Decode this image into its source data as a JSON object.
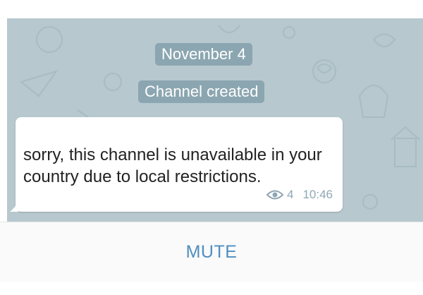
{
  "chat": {
    "date_label": "November 4",
    "service_message": "Channel created",
    "message": {
      "text": "sorry, this channel is unavailable in your country due to local restrictions.",
      "views": "4",
      "time": "10:46"
    }
  },
  "bottom_bar": {
    "mute_label": "MUTE"
  },
  "colors": {
    "chat_background": "#b7c8cf",
    "service_pill": "#8ba6b0",
    "accent": "#4f8fc1",
    "meta_text": "#8fa7b3"
  },
  "icons": [
    "eye-icon"
  ]
}
